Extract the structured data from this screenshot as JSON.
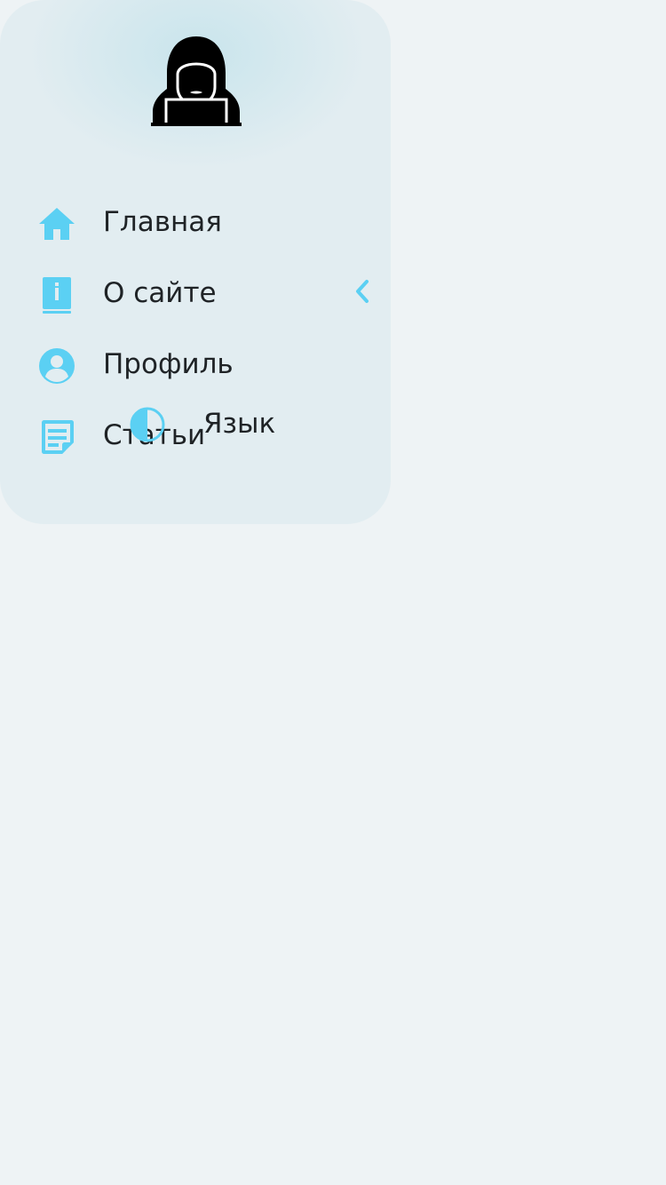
{
  "colors": {
    "page_background": "#eef3f5",
    "sidebar_background": "#e2edf1",
    "accent": "#5bd0f3",
    "text": "#1f2326",
    "logo": "#000000"
  },
  "sidebar": {
    "logo_icon": "hooded-hacker-icon",
    "items": [
      {
        "label": "Главная",
        "icon": "home-icon"
      },
      {
        "label": "О сайте",
        "icon": "info-book-icon"
      },
      {
        "label": "Профиль",
        "icon": "user-circle-icon"
      },
      {
        "label": "Статьи",
        "icon": "note-icon"
      }
    ],
    "expand_icon": "chevron-left-icon",
    "theme_toggle_icon": "half-circle-contrast-icon",
    "language_label": "Язык"
  }
}
